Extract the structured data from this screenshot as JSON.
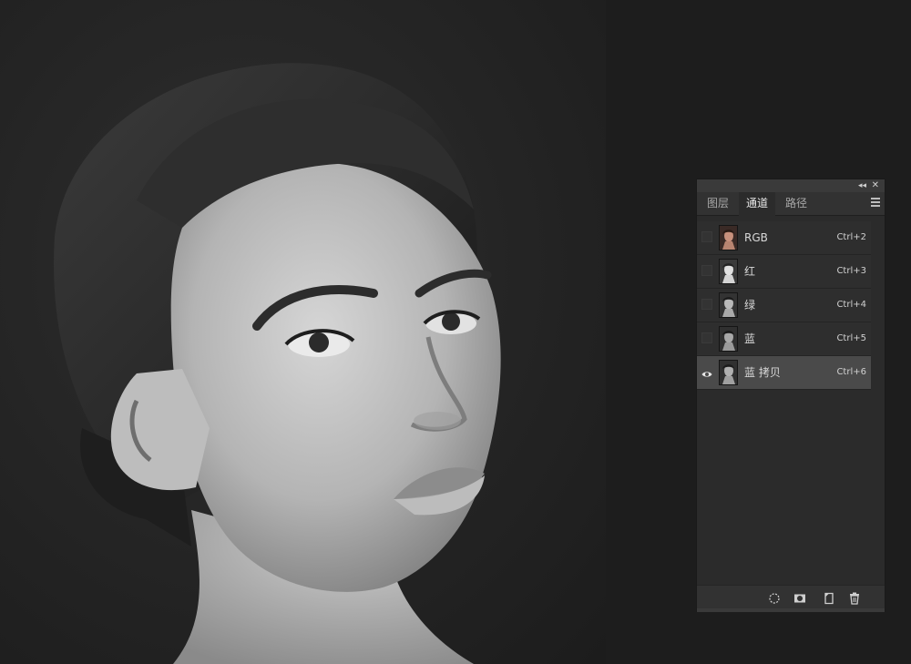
{
  "panel": {
    "tabs": [
      {
        "label": "图层",
        "active": false
      },
      {
        "label": "通道",
        "active": true
      },
      {
        "label": "路径",
        "active": false
      }
    ],
    "channels": [
      {
        "name": "RGB",
        "shortcut": "Ctrl+2",
        "visible": false,
        "selected": false,
        "thumb": "color"
      },
      {
        "name": "红",
        "shortcut": "Ctrl+3",
        "visible": false,
        "selected": false,
        "thumb": "gray"
      },
      {
        "name": "绿",
        "shortcut": "Ctrl+4",
        "visible": false,
        "selected": false,
        "thumb": "gray"
      },
      {
        "name": "蓝",
        "shortcut": "Ctrl+5",
        "visible": false,
        "selected": false,
        "thumb": "gray"
      },
      {
        "name": "蓝 拷贝",
        "shortcut": "Ctrl+6",
        "visible": true,
        "selected": true,
        "thumb": "gray"
      }
    ],
    "footer_icons": [
      "load-selection-icon",
      "save-selection-icon",
      "new-channel-icon",
      "delete-channel-icon"
    ]
  },
  "colors": {
    "panel_bg": "#2b2b2b",
    "selected_row": "#4a4a4a",
    "text": "#d8d8d8"
  }
}
